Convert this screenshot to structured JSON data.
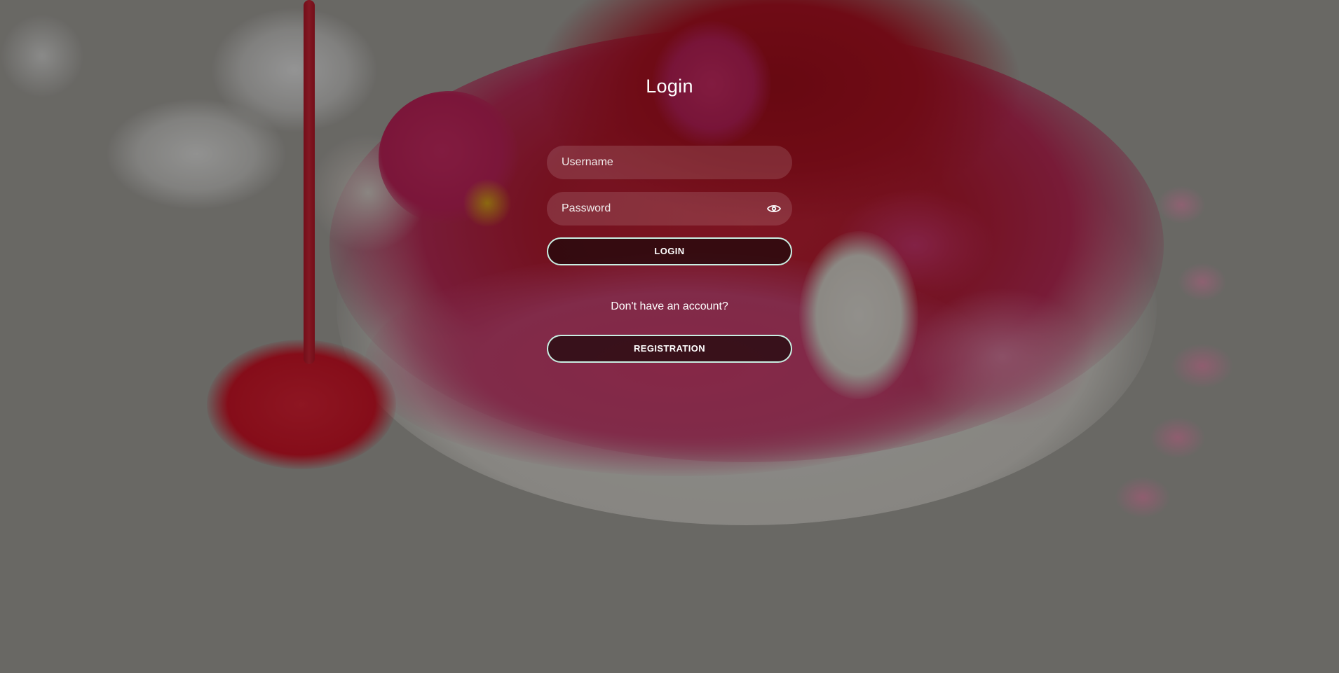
{
  "page": {
    "title": "Login"
  },
  "form": {
    "username": {
      "value": "",
      "placeholder": "Username"
    },
    "password": {
      "value": "",
      "placeholder": "Password",
      "toggle_icon": "eye-icon"
    },
    "login_button": "LOGIN",
    "no_account_text": "Don't have an account?",
    "registration_button": "REGISTRATION"
  },
  "colors": {
    "button_border": "#c9efe3",
    "text": "#ffffff"
  }
}
